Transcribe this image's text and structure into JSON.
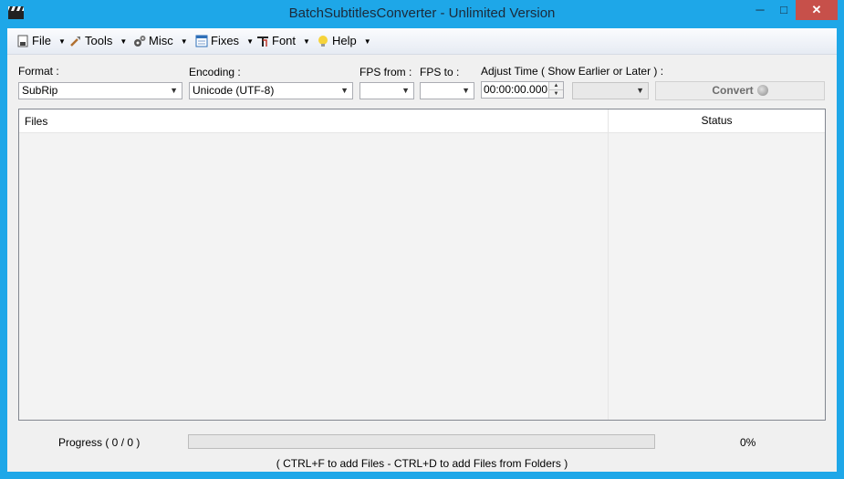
{
  "window": {
    "title": "BatchSubtitlesConverter - Unlimited Version"
  },
  "titlebar_buttons": {
    "minimize": "─",
    "maximize": "□",
    "close": "✕"
  },
  "menu": [
    {
      "label": "File",
      "icon": "file-icon"
    },
    {
      "label": "Tools",
      "icon": "tools-icon"
    },
    {
      "label": "Misc",
      "icon": "gears-icon"
    },
    {
      "label": "Fixes",
      "icon": "fixes-icon"
    },
    {
      "label": "Font",
      "icon": "font-icon"
    },
    {
      "label": "Help",
      "icon": "lightbulb-icon"
    }
  ],
  "labels": {
    "format": "Format :",
    "encoding": "Encoding :",
    "fps_from": "FPS from :",
    "fps_to": "FPS to :",
    "adjust_time": "Adjust Time ( Show Earlier or Later ) :"
  },
  "fields": {
    "format_value": "SubRip",
    "encoding_value": "Unicode (UTF-8)",
    "fps_from_value": "",
    "fps_to_value": "",
    "adjust_time_value": "00:00:00.000",
    "adjust_direction_value": ""
  },
  "convert_button": {
    "label": "Convert"
  },
  "file_list": {
    "col_files": "Files",
    "col_status": "Status"
  },
  "progress": {
    "label": "Progress ( 0 / 0 )",
    "value": 0,
    "percent_text": "0%"
  },
  "hint": "( CTRL+F to add Files - CTRL+D to add Files from Folders )",
  "colors": {
    "titlebar": "#1ea7e8",
    "close_button": "#c7504a",
    "progress_fill": "#06b025"
  }
}
